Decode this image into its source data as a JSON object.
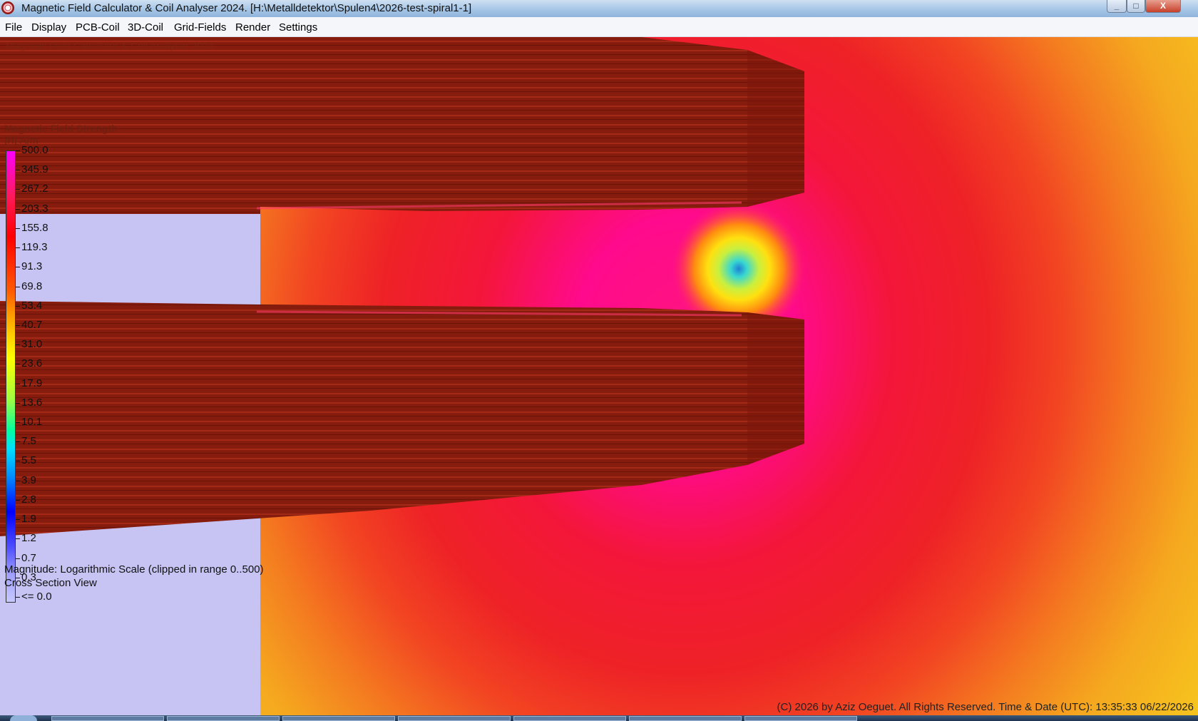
{
  "window": {
    "title": "Magnetic Field Calculator & Coil Analyser 2024.  [H:\\Metalldetektor\\Spulen4\\2026-test-spiral1-1]",
    "minimize_icon": "minimize-icon",
    "maximize_icon": "maximize-icon",
    "close_icon": "close-icon",
    "close_glyph": "X"
  },
  "menu": [
    "File",
    "Display",
    "PCB-Coil",
    "3D-Coil",
    "Grid-Fields",
    "Render",
    "Settings"
  ],
  "viewport": {
    "ghost_title": "Magnetic Field Calculator & Coil Analyser 2024",
    "legend_title": "Magnetic Field Strength",
    "legend_unit": "|H|  A/m",
    "legend_ticks": [
      "500.0",
      "345.9",
      "267.2",
      "203.3",
      "155.8",
      "119.3",
      "91.3",
      "69.8",
      "53.4",
      "40.7",
      "31.0",
      "23.6",
      "17.9",
      "13.6",
      "10.1",
      "7.5",
      "5.5",
      "3.9",
      "2.8",
      "1.9",
      "1.2",
      "0.7",
      "0.3",
      "<= 0.0"
    ],
    "magnitude_label": "Magnitude: Logarithmic Scale (clipped in range 0..500)",
    "view_label": "Cross Section View",
    "copyright": "(C) 2026  by Aziz Oeguet. All Rights Reserved.  Time & Date (UTC): 13:35:33  06/22/2026"
  },
  "colors": {
    "coil": "#8a1c0e",
    "coil_highlight": "#b8321c",
    "background_region": "#c7c4f4",
    "field_hot": "#f2202e",
    "field_magenta": "#ff0aa0",
    "field_warm": "#f5b71f"
  }
}
